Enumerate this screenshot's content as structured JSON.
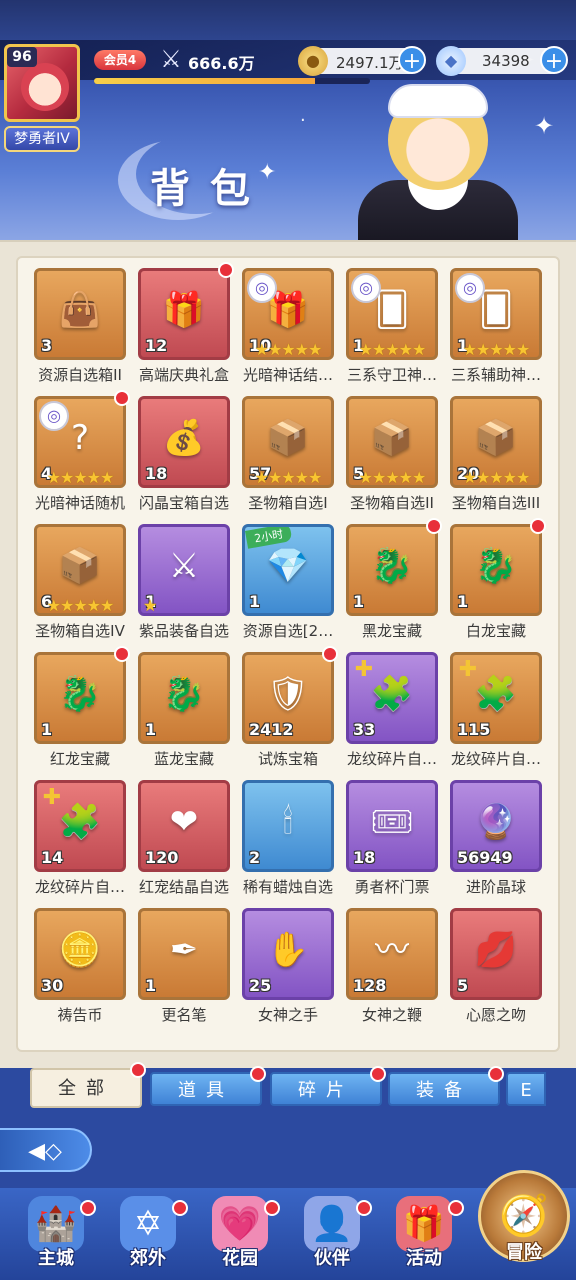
{
  "player": {
    "level": "96",
    "rank_title": "梦勇者IV",
    "vip": "会员4",
    "power": "666.6万",
    "xp_progress": 0.8
  },
  "currencies": {
    "gold": "2497.1万",
    "gems": "34398"
  },
  "page_title": "背包",
  "items": [
    {
      "name": "资源自选箱II",
      "qty": "3",
      "color": "orange",
      "icon": "bag-icon",
      "glyph": "👜",
      "stars": 0,
      "dot": false,
      "badge": ""
    },
    {
      "name": "高端庆典礼盒",
      "qty": "12",
      "color": "red",
      "icon": "giftbox-icon",
      "glyph": "🎁",
      "stars": 0,
      "dot": true,
      "badge": ""
    },
    {
      "name": "光暗神话结…",
      "qty": "10",
      "color": "orange",
      "icon": "gift-icon",
      "glyph": "🎁",
      "stars": 5,
      "dot": false,
      "badge": "type"
    },
    {
      "name": "三系守卫神…",
      "qty": "1",
      "color": "orange",
      "icon": "card-icon",
      "glyph": "🂠",
      "stars": 5,
      "dot": false,
      "badge": "type"
    },
    {
      "name": "三系辅助神…",
      "qty": "1",
      "color": "orange",
      "icon": "card-icon",
      "glyph": "🂠",
      "stars": 5,
      "dot": false,
      "badge": "type"
    },
    {
      "name": "光暗神话随机",
      "qty": "4",
      "color": "orange",
      "icon": "random-card-icon",
      "glyph": "?",
      "stars": 5,
      "dot": true,
      "badge": "type"
    },
    {
      "name": "闪晶宝箱自选",
      "qty": "18",
      "color": "red",
      "icon": "chest-icon",
      "glyph": "💰",
      "stars": 0,
      "dot": false,
      "badge": ""
    },
    {
      "name": "圣物箱自选I",
      "qty": "57",
      "color": "orange",
      "icon": "relic-box-icon",
      "glyph": "📦",
      "stars": 5,
      "dot": false,
      "badge": ""
    },
    {
      "name": "圣物箱自选II",
      "qty": "5",
      "color": "orange",
      "icon": "relic-box-icon",
      "glyph": "📦",
      "stars": 5,
      "dot": false,
      "badge": ""
    },
    {
      "name": "圣物箱自选III",
      "qty": "20",
      "color": "orange",
      "icon": "relic-box-icon",
      "glyph": "📦",
      "stars": 5,
      "dot": false,
      "badge": ""
    },
    {
      "name": "圣物箱自选IV",
      "qty": "6",
      "color": "orange",
      "icon": "relic-box-icon",
      "glyph": "📦",
      "stars": 5,
      "dot": false,
      "badge": ""
    },
    {
      "name": "紫品装备自选",
      "qty": "1",
      "color": "purple",
      "icon": "equip-box-icon",
      "glyph": "⚔",
      "stars": 1,
      "dot": false,
      "badge": ""
    },
    {
      "name": "资源自选[2…",
      "qty": "1",
      "color": "blue",
      "icon": "resource-chest-icon",
      "glyph": "💎",
      "stars": 0,
      "dot": false,
      "badge": "time",
      "time": "2小时"
    },
    {
      "name": "黑龙宝藏",
      "qty": "1",
      "color": "orange",
      "icon": "dragon-chest-icon",
      "glyph": "🐉",
      "stars": 0,
      "dot": true,
      "badge": ""
    },
    {
      "name": "白龙宝藏",
      "qty": "1",
      "color": "orange",
      "icon": "dragon-chest-icon",
      "glyph": "🐉",
      "stars": 0,
      "dot": true,
      "badge": ""
    },
    {
      "name": "红龙宝藏",
      "qty": "1",
      "color": "orange",
      "icon": "dragon-chest-icon",
      "glyph": "🐉",
      "stars": 0,
      "dot": true,
      "badge": ""
    },
    {
      "name": "蓝龙宝藏",
      "qty": "1",
      "color": "orange",
      "icon": "dragon-chest-icon",
      "glyph": "🐉",
      "stars": 0,
      "dot": false,
      "badge": ""
    },
    {
      "name": "试炼宝箱",
      "qty": "2412",
      "color": "orange",
      "icon": "trial-chest-icon",
      "glyph": "🛡",
      "stars": 0,
      "dot": true,
      "badge": ""
    },
    {
      "name": "龙纹碎片自…",
      "qty": "33",
      "color": "purple",
      "icon": "fragment-icon",
      "glyph": "🧩",
      "stars": 0,
      "dot": false,
      "badge": "puzzle"
    },
    {
      "name": "龙纹碎片自…",
      "qty": "115",
      "color": "orange",
      "icon": "fragment-icon",
      "glyph": "🧩",
      "stars": 0,
      "dot": false,
      "badge": "puzzle"
    },
    {
      "name": "龙纹碎片自…",
      "qty": "14",
      "color": "red",
      "icon": "fragment-icon",
      "glyph": "🧩",
      "stars": 0,
      "dot": false,
      "badge": "puzzle"
    },
    {
      "name": "红宠结晶自选",
      "qty": "120",
      "color": "red",
      "icon": "crystal-icon",
      "glyph": "❤",
      "stars": 0,
      "dot": false,
      "badge": ""
    },
    {
      "name": "稀有蜡烛自选",
      "qty": "2",
      "color": "blue",
      "icon": "candle-box-icon",
      "glyph": "🕯",
      "stars": 0,
      "dot": false,
      "badge": ""
    },
    {
      "name": "勇者杯门票",
      "qty": "18",
      "color": "purple",
      "icon": "ticket-icon",
      "glyph": "🎟",
      "stars": 0,
      "dot": false,
      "badge": ""
    },
    {
      "name": "进阶晶球",
      "qty": "56949",
      "color": "purple",
      "icon": "crystal-ball-icon",
      "glyph": "🔮",
      "stars": 0,
      "dot": false,
      "badge": ""
    },
    {
      "name": "祷告币",
      "qty": "30",
      "color": "orange",
      "icon": "coin-icon",
      "glyph": "🪙",
      "stars": 0,
      "dot": false,
      "badge": ""
    },
    {
      "name": "更名笔",
      "qty": "1",
      "color": "orange",
      "icon": "quill-icon",
      "glyph": "✒",
      "stars": 0,
      "dot": false,
      "badge": ""
    },
    {
      "name": "女神之手",
      "qty": "25",
      "color": "purple",
      "icon": "hand-icon",
      "glyph": "✋",
      "stars": 0,
      "dot": false,
      "badge": ""
    },
    {
      "name": "女神之鞭",
      "qty": "128",
      "color": "orange",
      "icon": "whip-icon",
      "glyph": "〰",
      "stars": 0,
      "dot": false,
      "badge": ""
    },
    {
      "name": "心愿之吻",
      "qty": "5",
      "color": "red",
      "icon": "kiss-icon",
      "glyph": "💋",
      "stars": 0,
      "dot": false,
      "badge": ""
    }
  ],
  "tabs": [
    {
      "label": "全部",
      "active": true,
      "dot": true
    },
    {
      "label": "道具",
      "active": false,
      "dot": true
    },
    {
      "label": "碎片",
      "active": false,
      "dot": true
    },
    {
      "label": "装备",
      "active": false,
      "dot": true
    },
    {
      "label": "E",
      "active": false,
      "dot": false
    }
  ],
  "dock": [
    {
      "label": "主城",
      "icon": "castle-icon",
      "glyph": "🏰",
      "dot": true
    },
    {
      "label": "郊外",
      "icon": "compass-icon",
      "glyph": "✡",
      "dot": true
    },
    {
      "label": "花园",
      "icon": "garden-icon",
      "glyph": "💗",
      "dot": true
    },
    {
      "label": "伙伴",
      "icon": "partner-icon",
      "glyph": "👤",
      "dot": true
    },
    {
      "label": "活动",
      "icon": "event-gift-icon",
      "glyph": "🎁",
      "dot": true
    }
  ],
  "adventure_label": "冒险"
}
